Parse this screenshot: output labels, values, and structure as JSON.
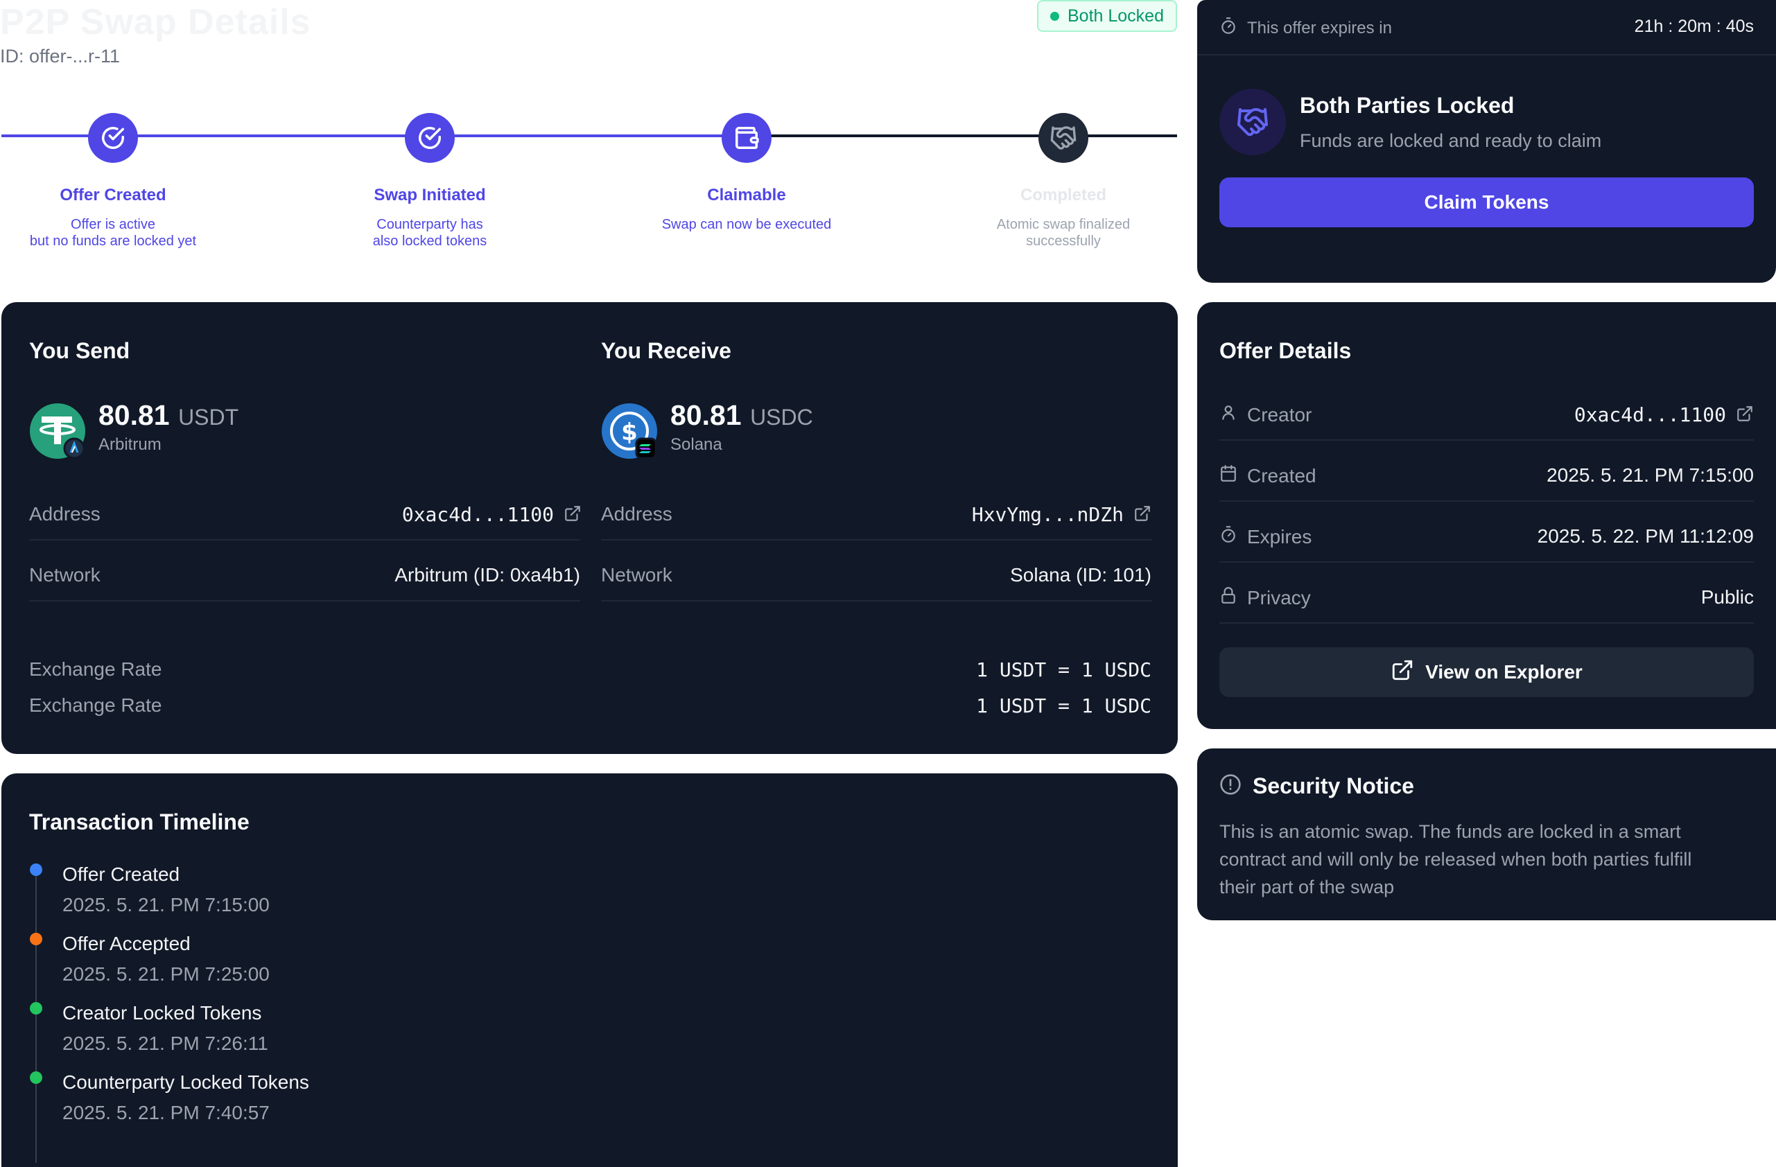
{
  "header": {
    "title": "P2P Swap Details",
    "id_text": "ID: offer-...r-11",
    "status": "Both Locked"
  },
  "colors": {
    "accent": "#4f46e5",
    "step_active": "#4f46e5",
    "card_bg": "#111827",
    "success": "#10b981"
  },
  "steps": [
    {
      "title": "Offer Created",
      "desc_line1": "Offer is active",
      "desc_line2": "but no funds are locked yet",
      "icon": "check-circle-icon",
      "state": "done"
    },
    {
      "title": "Swap Initiated",
      "desc_line1": "Counterparty has",
      "desc_line2": "also locked tokens",
      "icon": "check-circle-icon",
      "state": "done"
    },
    {
      "title": "Claimable",
      "desc_line1": "Swap can now be executed",
      "desc_line2": "",
      "icon": "wallet-icon",
      "state": "current"
    },
    {
      "title": "Completed",
      "desc_line1": "Atomic swap finalized",
      "desc_line2": "successfully",
      "icon": "handshake-icon",
      "state": "pending"
    }
  ],
  "send": {
    "heading": "You Send",
    "amount": "80.81",
    "symbol": "USDT",
    "chain": "Arbitrum",
    "token_icon": "tether-icon",
    "chain_icon": "arbitrum-icon",
    "address_label": "Address",
    "address": "0xac4d...1100",
    "network_label": "Network",
    "network": "Arbitrum (ID: 0xa4b1)"
  },
  "receive": {
    "heading": "You Receive",
    "amount": "80.81",
    "symbol": "USDC",
    "chain": "Solana",
    "token_icon": "usdc-icon",
    "chain_icon": "solana-icon",
    "address_label": "Address",
    "address": "HxvYmg...nDZh",
    "network_label": "Network",
    "network": "Solana (ID: 101)"
  },
  "exchange": [
    {
      "label": "Exchange Rate",
      "value": "1 USDT = 1 USDC"
    },
    {
      "label": "Exchange Rate",
      "value": "1 USDT = 1 USDC"
    }
  ],
  "timeline": {
    "heading": "Transaction Timeline",
    "events": [
      {
        "title": "Offer Created",
        "time": "2025. 5. 21. PM 7:15:00",
        "color": "#3b82f6"
      },
      {
        "title": "Offer Accepted",
        "time": "2025. 5. 21. PM 7:25:00",
        "color": "#f97316"
      },
      {
        "title": "Creator Locked Tokens",
        "time": "2025. 5. 21. PM 7:26:11",
        "color": "#22c55e"
      },
      {
        "title": "Counterparty Locked Tokens",
        "time": "2025. 5. 21. PM 7:40:57",
        "color": "#22c55e"
      }
    ]
  },
  "expiry": {
    "label": "This offer expires in",
    "countdown": "21h : 20m : 40s",
    "status_title": "Both Parties Locked",
    "status_desc": "Funds are locked and ready to claim",
    "claim_button": "Claim Tokens"
  },
  "offer_details": {
    "heading": "Offer Details",
    "rows": [
      {
        "label": "Creator",
        "value": "0xac4d...1100",
        "icon": "user-icon"
      },
      {
        "label": "Created",
        "value": "2025. 5. 21. PM 7:15:00",
        "icon": "calendar-icon"
      },
      {
        "label": "Expires",
        "value": "2025. 5. 22. PM 11:12:09",
        "icon": "timer-icon"
      },
      {
        "label": "Privacy",
        "value": "Public",
        "icon": "lock-icon"
      }
    ],
    "explorer_button": "View on Explorer"
  },
  "security": {
    "heading": "Security Notice",
    "line1": "This is an atomic swap. The funds are locked in a smart",
    "line2": "contract and will only be released when both parties fulfill",
    "line3": "their part of the swap"
  }
}
